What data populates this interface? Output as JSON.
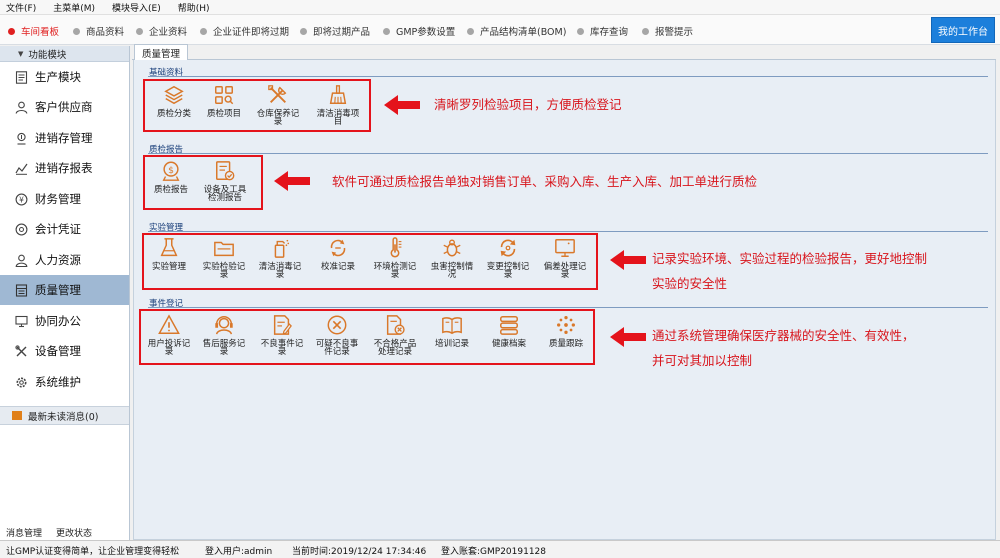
{
  "menubar": {
    "items": [
      {
        "label": "文件(F)"
      },
      {
        "label": "主菜单(M)"
      },
      {
        "label": "模块导入(E)"
      },
      {
        "label": "帮助(H)"
      }
    ]
  },
  "quickbar": {
    "items": [
      {
        "label": "车间看板",
        "active": true
      },
      {
        "label": "商品资料"
      },
      {
        "label": "企业资料"
      },
      {
        "label": "企业证件即将过期"
      },
      {
        "label": "即将过期产品"
      },
      {
        "label": "GMP参数设置"
      },
      {
        "label": "产品结构清单(BOM)"
      },
      {
        "label": "库存查询"
      },
      {
        "label": "报警提示"
      }
    ],
    "workbench_label": "我的工作台"
  },
  "sidebar": {
    "header": "功能模块",
    "items": [
      {
        "label": "生产模块",
        "icon": "list-icon"
      },
      {
        "label": "客户供应商",
        "icon": "person-icon"
      },
      {
        "label": "进销存管理",
        "icon": "inventory-icon"
      },
      {
        "label": "进销存报表",
        "icon": "chart-icon"
      },
      {
        "label": "财务管理",
        "icon": "money-icon"
      },
      {
        "label": "会计凭证",
        "icon": "voucher-icon"
      },
      {
        "label": "人力资源",
        "icon": "user-icon"
      },
      {
        "label": "质量管理",
        "icon": "quality-icon",
        "active": true
      },
      {
        "label": "协同办公",
        "icon": "monitor-icon"
      },
      {
        "label": "设备管理",
        "icon": "tools-icon"
      },
      {
        "label": "系统维护",
        "icon": "gear-icon"
      }
    ],
    "unread": "最新未读消息(0)",
    "bottom_links": [
      {
        "label": "消息管理"
      },
      {
        "label": "更改状态"
      }
    ]
  },
  "tab": {
    "label": "质量管理"
  },
  "sections": [
    {
      "title": "基础资料",
      "modules": [
        {
          "label": "质检分类",
          "icon": "layers-icon"
        },
        {
          "label": "质检项目",
          "icon": "grid-search-icon"
        },
        {
          "label": "仓库保养记录",
          "icon": "wrench-icon"
        },
        {
          "label": "清洁消毒项目",
          "icon": "broom-icon"
        }
      ],
      "annotation": "清晰罗列检验项目，方便质检登记"
    },
    {
      "title": "质检报告",
      "modules": [
        {
          "label": "质检报告",
          "icon": "stamp-icon"
        },
        {
          "label": "设备及工具检测报告",
          "icon": "report-check-icon"
        }
      ],
      "annotation": "软件可通过质检报告单独对销售订单、采购入库、生产入库、加工单进行质检"
    },
    {
      "title": "实验管理",
      "modules": [
        {
          "label": "实验管理",
          "icon": "flask-icon"
        },
        {
          "label": "实验检验记录",
          "icon": "folder-icon"
        },
        {
          "label": "清洁消毒记录",
          "icon": "spray-icon"
        },
        {
          "label": "校准记录",
          "icon": "calibrate-icon"
        },
        {
          "label": "环境检测记录",
          "icon": "thermometer-icon"
        },
        {
          "label": "虫害控制情况",
          "icon": "bug-icon"
        },
        {
          "label": "变更控制记录",
          "icon": "refresh-icon"
        },
        {
          "label": "偏差处理记录",
          "icon": "screen-icon"
        }
      ],
      "annotation_lines": [
        "记录实验环境、实验过程的检验报告，更好地控制",
        "实验的安全性"
      ]
    },
    {
      "title": "事件登记",
      "modules": [
        {
          "label": "用户投诉记录",
          "icon": "warning-icon"
        },
        {
          "label": "售后服务记录",
          "icon": "headset-icon"
        },
        {
          "label": "不良事件记录",
          "icon": "edit-doc-icon"
        },
        {
          "label": "可疑不良事件记录",
          "icon": "x-circle-icon"
        },
        {
          "label": "不合格产品处理记录",
          "icon": "doc-x-icon"
        },
        {
          "label": "培训记录",
          "icon": "book-icon"
        },
        {
          "label": "健康档案",
          "icon": "database-icon"
        },
        {
          "label": "质量跟踪",
          "icon": "dots-icon"
        }
      ],
      "annotation_lines": [
        "通过系统管理确保医疗器械的安全性、有效性，",
        "并可对其加以控制"
      ]
    }
  ],
  "statusbar": {
    "slogan": "让GMP认证变得简单，让企业管理变得轻松",
    "user": "登入用户:admin",
    "time": "当前时间:2019/12/24 17:34:46",
    "account": "登入账套:GMP20191128"
  },
  "colors": {
    "icon_orange": "#d9782a",
    "annotation_red": "#d8151c",
    "active_nav": "#9fb8d3",
    "workbench_blue": "#1c7fdb"
  }
}
